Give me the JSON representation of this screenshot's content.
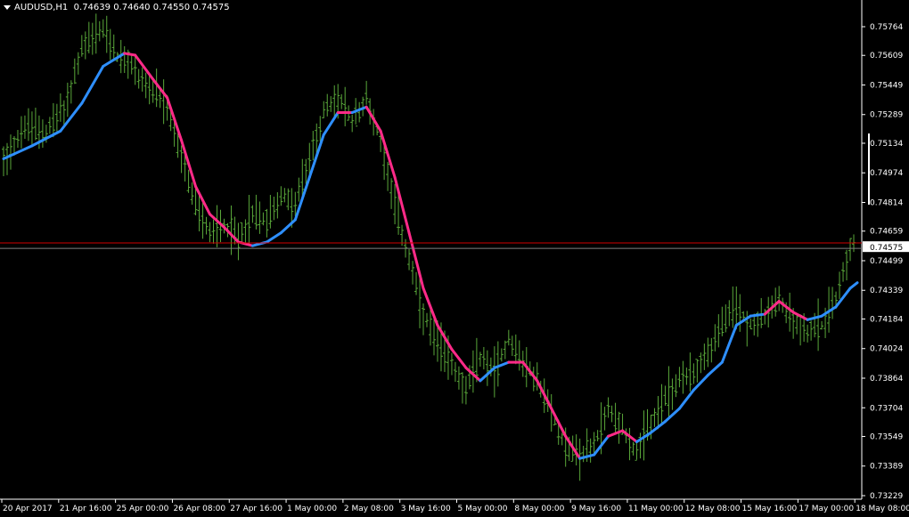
{
  "header": {
    "symbol": "AUDUSD,H1",
    "ohlc": "0.74639 0.74640 0.74550 0.74575"
  },
  "colors": {
    "background": "#000000",
    "candles": "#5aa83a",
    "ma_up": "#2e8fff",
    "ma_down": "#ff2a88",
    "bid_line": "#d00000",
    "ask_line": "#808080",
    "axis": "#ffffff",
    "price_tag_bg": "#ffffff"
  },
  "chart_data": {
    "type": "line",
    "symbol": "AUDUSD",
    "timeframe": "H1",
    "y_ticks": [
      "0.75764",
      "0.75609",
      "0.75449",
      "0.75289",
      "0.75134",
      "0.74974",
      "0.74814",
      "0.74659",
      "0.74499",
      "0.74339",
      "0.74184",
      "0.74024",
      "0.73864",
      "0.73704",
      "0.73549",
      "0.73389",
      "0.73229"
    ],
    "ylim": [
      0.73229,
      0.75764
    ],
    "x_ticks": [
      "20 Apr 2017",
      "21 Apr 16:00",
      "25 Apr 00:00",
      "26 Apr 08:00",
      "27 Apr 16:00",
      "1 May 00:00",
      "2 May 08:00",
      "3 May 16:00",
      "5 May 00:00",
      "8 May 00:00",
      "9 May 16:00",
      "11 May 00:00",
      "12 May 08:00",
      "15 May 16:00",
      "17 May 00:00",
      "18 May 08:00"
    ],
    "current_price": "0.74575",
    "current_price_value": 0.74575,
    "ask_price_value": 0.74595,
    "bars": 240,
    "price_series": [
      {
        "t": 0,
        "p": 0.7505
      },
      {
        "t": 6,
        "p": 0.7522
      },
      {
        "t": 12,
        "p": 0.752
      },
      {
        "t": 18,
        "p": 0.7535
      },
      {
        "t": 22,
        "p": 0.7565
      },
      {
        "t": 28,
        "p": 0.7575
      },
      {
        "t": 32,
        "p": 0.756
      },
      {
        "t": 36,
        "p": 0.7555
      },
      {
        "t": 40,
        "p": 0.7545
      },
      {
        "t": 46,
        "p": 0.7532
      },
      {
        "t": 50,
        "p": 0.7505
      },
      {
        "t": 54,
        "p": 0.748
      },
      {
        "t": 58,
        "p": 0.7465
      },
      {
        "t": 62,
        "p": 0.747
      },
      {
        "t": 66,
        "p": 0.7462
      },
      {
        "t": 70,
        "p": 0.7475
      },
      {
        "t": 74,
        "p": 0.7472
      },
      {
        "t": 78,
        "p": 0.7485
      },
      {
        "t": 82,
        "p": 0.748
      },
      {
        "t": 86,
        "p": 0.7505
      },
      {
        "t": 90,
        "p": 0.753
      },
      {
        "t": 94,
        "p": 0.7538
      },
      {
        "t": 98,
        "p": 0.7525
      },
      {
        "t": 102,
        "p": 0.7538
      },
      {
        "t": 106,
        "p": 0.7515
      },
      {
        "t": 110,
        "p": 0.748
      },
      {
        "t": 114,
        "p": 0.745
      },
      {
        "t": 118,
        "p": 0.742
      },
      {
        "t": 122,
        "p": 0.7405
      },
      {
        "t": 126,
        "p": 0.7395
      },
      {
        "t": 130,
        "p": 0.738
      },
      {
        "t": 134,
        "p": 0.7398
      },
      {
        "t": 138,
        "p": 0.739
      },
      {
        "t": 142,
        "p": 0.7408
      },
      {
        "t": 146,
        "p": 0.7395
      },
      {
        "t": 150,
        "p": 0.7385
      },
      {
        "t": 154,
        "p": 0.7368
      },
      {
        "t": 158,
        "p": 0.735
      },
      {
        "t": 162,
        "p": 0.7345
      },
      {
        "t": 166,
        "p": 0.735
      },
      {
        "t": 170,
        "p": 0.737
      },
      {
        "t": 174,
        "p": 0.736
      },
      {
        "t": 178,
        "p": 0.7345
      },
      {
        "t": 182,
        "p": 0.7362
      },
      {
        "t": 186,
        "p": 0.7375
      },
      {
        "t": 190,
        "p": 0.7385
      },
      {
        "t": 194,
        "p": 0.739
      },
      {
        "t": 198,
        "p": 0.74
      },
      {
        "t": 202,
        "p": 0.7415
      },
      {
        "t": 206,
        "p": 0.7425
      },
      {
        "t": 210,
        "p": 0.7415
      },
      {
        "t": 214,
        "p": 0.742
      },
      {
        "t": 218,
        "p": 0.7428
      },
      {
        "t": 222,
        "p": 0.7418
      },
      {
        "t": 226,
        "p": 0.7412
      },
      {
        "t": 230,
        "p": 0.7415
      },
      {
        "t": 234,
        "p": 0.743
      },
      {
        "t": 238,
        "p": 0.7458
      },
      {
        "t": 240,
        "p": 0.7462
      }
    ],
    "ma_series": [
      {
        "t": 0,
        "p": 0.7505,
        "dir": "up"
      },
      {
        "t": 8,
        "p": 0.7512,
        "dir": "up"
      },
      {
        "t": 16,
        "p": 0.752,
        "dir": "up"
      },
      {
        "t": 22,
        "p": 0.7535,
        "dir": "up"
      },
      {
        "t": 28,
        "p": 0.7555,
        "dir": "up"
      },
      {
        "t": 34,
        "p": 0.7562,
        "dir": "up"
      },
      {
        "t": 37,
        "p": 0.7561,
        "dir": "down"
      },
      {
        "t": 42,
        "p": 0.7548,
        "dir": "down"
      },
      {
        "t": 46,
        "p": 0.7538,
        "dir": "down"
      },
      {
        "t": 50,
        "p": 0.7515,
        "dir": "down"
      },
      {
        "t": 54,
        "p": 0.749,
        "dir": "down"
      },
      {
        "t": 58,
        "p": 0.7475,
        "dir": "down"
      },
      {
        "t": 62,
        "p": 0.7468,
        "dir": "down"
      },
      {
        "t": 66,
        "p": 0.746,
        "dir": "down"
      },
      {
        "t": 70,
        "p": 0.7458,
        "dir": "down"
      },
      {
        "t": 74,
        "p": 0.746,
        "dir": "up"
      },
      {
        "t": 78,
        "p": 0.7465,
        "dir": "up"
      },
      {
        "t": 82,
        "p": 0.7472,
        "dir": "up"
      },
      {
        "t": 86,
        "p": 0.7495,
        "dir": "up"
      },
      {
        "t": 90,
        "p": 0.7518,
        "dir": "up"
      },
      {
        "t": 94,
        "p": 0.753,
        "dir": "up"
      },
      {
        "t": 98,
        "p": 0.753,
        "dir": "down"
      },
      {
        "t": 102,
        "p": 0.7533,
        "dir": "up"
      },
      {
        "t": 106,
        "p": 0.752,
        "dir": "down"
      },
      {
        "t": 110,
        "p": 0.7495,
        "dir": "down"
      },
      {
        "t": 114,
        "p": 0.7465,
        "dir": "down"
      },
      {
        "t": 118,
        "p": 0.7435,
        "dir": "down"
      },
      {
        "t": 122,
        "p": 0.7415,
        "dir": "down"
      },
      {
        "t": 126,
        "p": 0.7402,
        "dir": "down"
      },
      {
        "t": 130,
        "p": 0.7392,
        "dir": "down"
      },
      {
        "t": 134,
        "p": 0.7385,
        "dir": "down"
      },
      {
        "t": 138,
        "p": 0.7392,
        "dir": "up"
      },
      {
        "t": 142,
        "p": 0.7395,
        "dir": "up"
      },
      {
        "t": 146,
        "p": 0.7395,
        "dir": "down"
      },
      {
        "t": 150,
        "p": 0.7385,
        "dir": "down"
      },
      {
        "t": 154,
        "p": 0.737,
        "dir": "down"
      },
      {
        "t": 158,
        "p": 0.7355,
        "dir": "down"
      },
      {
        "t": 162,
        "p": 0.7343,
        "dir": "down"
      },
      {
        "t": 166,
        "p": 0.7345,
        "dir": "up"
      },
      {
        "t": 170,
        "p": 0.7355,
        "dir": "up"
      },
      {
        "t": 174,
        "p": 0.7358,
        "dir": "down"
      },
      {
        "t": 178,
        "p": 0.7352,
        "dir": "down"
      },
      {
        "t": 182,
        "p": 0.7357,
        "dir": "up"
      },
      {
        "t": 186,
        "p": 0.7363,
        "dir": "up"
      },
      {
        "t": 190,
        "p": 0.737,
        "dir": "up"
      },
      {
        "t": 194,
        "p": 0.738,
        "dir": "up"
      },
      {
        "t": 198,
        "p": 0.7388,
        "dir": "up"
      },
      {
        "t": 202,
        "p": 0.7395,
        "dir": "up"
      },
      {
        "t": 206,
        "p": 0.7415,
        "dir": "up"
      },
      {
        "t": 210,
        "p": 0.742,
        "dir": "up"
      },
      {
        "t": 214,
        "p": 0.7421,
        "dir": "up"
      },
      {
        "t": 218,
        "p": 0.7428,
        "dir": "down"
      },
      {
        "t": 222,
        "p": 0.7422,
        "dir": "down"
      },
      {
        "t": 226,
        "p": 0.7418,
        "dir": "down"
      },
      {
        "t": 230,
        "p": 0.742,
        "dir": "up"
      },
      {
        "t": 234,
        "p": 0.7425,
        "dir": "up"
      },
      {
        "t": 238,
        "p": 0.7435,
        "dir": "up"
      },
      {
        "t": 240,
        "p": 0.7438,
        "dir": "up"
      }
    ]
  }
}
